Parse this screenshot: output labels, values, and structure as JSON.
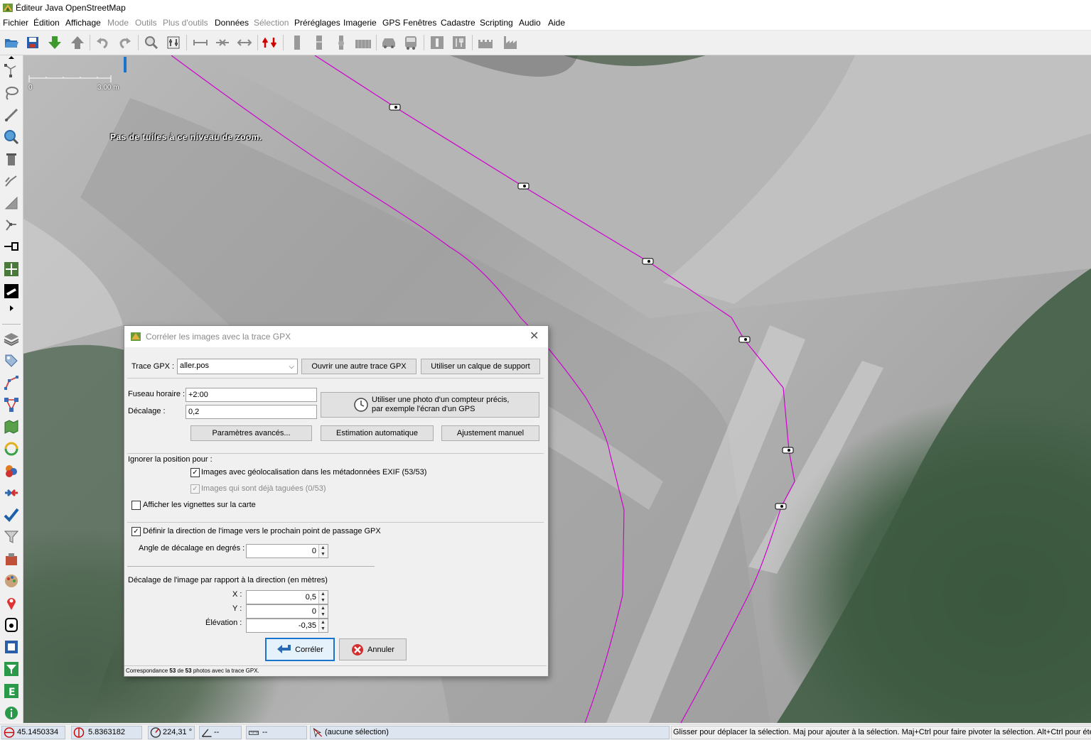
{
  "window": {
    "title": "Éditeur Java OpenStreetMap"
  },
  "menu": {
    "items": [
      {
        "label": "Fichier",
        "enabled": true
      },
      {
        "label": "Édition",
        "enabled": true
      },
      {
        "label": "Affichage",
        "enabled": true
      },
      {
        "label": "Mode",
        "enabled": false
      },
      {
        "label": "Outils",
        "enabled": false
      },
      {
        "label": "Plus d'outils",
        "enabled": false
      },
      {
        "label": "Données",
        "enabled": true
      },
      {
        "label": "Sélection",
        "enabled": false
      },
      {
        "label": "Préréglages",
        "enabled": true
      },
      {
        "label": "Imagerie",
        "enabled": true
      },
      {
        "label": "GPS",
        "enabled": true
      },
      {
        "label": "Fenêtres",
        "enabled": true
      },
      {
        "label": "Cadastre",
        "enabled": true
      },
      {
        "label": "Scripting",
        "enabled": true
      },
      {
        "label": "Audio",
        "enabled": true
      },
      {
        "label": "Aide",
        "enabled": true
      }
    ]
  },
  "map": {
    "scale_start": "0",
    "scale_end": "3.00 m",
    "no_tiles_message": "Pas de tuiles à ce niveau de zoom."
  },
  "dialog": {
    "title": "Corréler les images avec la trace GPX",
    "gpx_trace_label": "Trace GPX :",
    "gpx_trace_value": "aller.pos",
    "open_other_button": "Ouvrir une autre trace GPX",
    "use_support_layer_button": "Utiliser un calque de support",
    "timezone_label": "Fuseau horaire :",
    "timezone_value": "+2:00",
    "offset_label": "Décalage :",
    "offset_value": "0,2",
    "photo_clock_button_line1": "Utiliser une photo d'un compteur précis,",
    "photo_clock_button_line2": "par exemple l'écran d'un GPS",
    "advanced_button": "Paramètres avancés...",
    "auto_estimate_button": "Estimation automatique",
    "manual_adjust_button": "Ajustement manuel",
    "ignore_position_label": "Ignorer la position pour :",
    "exif_geo_checkbox": "Images avec géolocalisation dans les métadonnées EXIF (53/53)",
    "exif_geo_checked": true,
    "already_tagged_checkbox": "Images qui sont déjà taguées (0/53)",
    "already_tagged_checked": true,
    "show_thumbnails_checkbox": "Afficher les vignettes sur la carte",
    "show_thumbnails_checked": false,
    "set_direction_checkbox": "Définir la direction de l'image vers le prochain point de passage GPX",
    "set_direction_checked": true,
    "angle_offset_label": "Angle de décalage en degrés :",
    "angle_offset_value": "0",
    "image_offset_title": "Décalage de l'image par rapport à la direction (en mètres)",
    "x_label": "X :",
    "x_value": "0,5",
    "y_label": "Y :",
    "y_value": "0",
    "elevation_label": "Élévation :",
    "elevation_value": "-0,35",
    "correlate_button": "Corréler",
    "cancel_button": "Annuler",
    "status_prefix": "Correspondance",
    "status_matched": "53",
    "status_of": "de",
    "status_total": "53",
    "status_suffix": "photos avec la trace GPX."
  },
  "statusbar": {
    "latitude": "45.1450334",
    "longitude": "5.8363182",
    "heading": "224,31 °",
    "angle": "--",
    "distance": "--",
    "selection": "(aucune sélection)",
    "help": "Glisser pour déplacer la sélection. Maj pour ajouter à la sélection. Maj+Ctrl pour faire pivoter la sélection. Alt+Ctrl pour éte"
  },
  "colors": {
    "gpx_track": "#d000d0",
    "accent": "#1874cd"
  }
}
